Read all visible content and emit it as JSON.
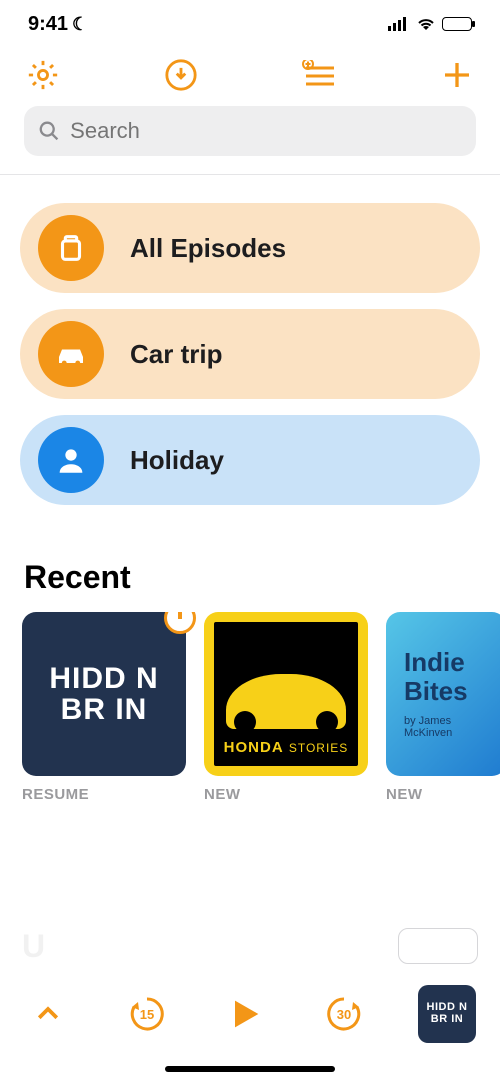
{
  "status": {
    "time": "9:41"
  },
  "search": {
    "placeholder": "Search"
  },
  "categories": [
    {
      "label": "All Episodes",
      "icon": "episodes",
      "color": "orange"
    },
    {
      "label": "Car trip",
      "icon": "car",
      "color": "orange"
    },
    {
      "label": "Holiday",
      "icon": "person",
      "color": "blue"
    }
  ],
  "recent": {
    "title": "Recent",
    "items": [
      {
        "title_line1": "HIDD N",
        "title_line2": "BR  IN",
        "status": "RESUME"
      },
      {
        "brand": "HONDA",
        "subbrand": "STORIES",
        "status": "NEW"
      },
      {
        "title_line1": "Indie",
        "title_line2": "Bites",
        "byline": "by James McKinven",
        "status": "NEW"
      }
    ]
  },
  "player": {
    "skip_back": "15",
    "skip_fwd": "30",
    "art_line1": "HIDD N",
    "art_line2": "BR  IN"
  },
  "accent": "#f39617"
}
